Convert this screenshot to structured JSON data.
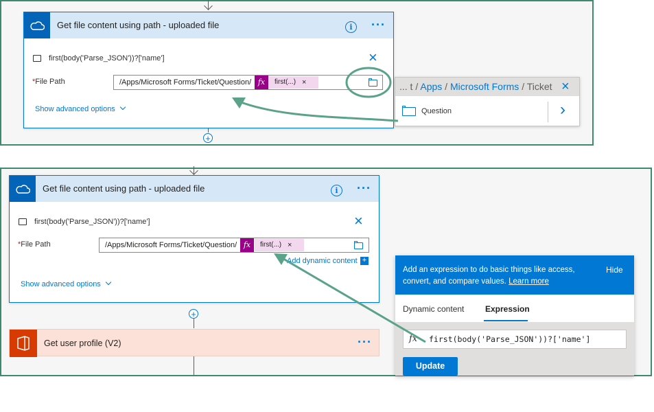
{
  "top_panel": {
    "card": {
      "title": "Get file content using path - uploaded file",
      "info_glyph": "i",
      "more_glyph": "···",
      "expression": "first(body('Parse_JSON'))?['name']",
      "close_glyph": "×",
      "file_path_label": "File Path",
      "required_mark": "*",
      "path_value": "/Apps/Microsoft Forms/Ticket/Question/",
      "fx_glyph": "fx",
      "token_label": "first(...)",
      "token_remove": "×",
      "show_advanced": "Show advanced options"
    },
    "folder_browser": {
      "crumbs": [
        "... t",
        "Apps",
        "Microsoft Forms",
        "Ticket"
      ],
      "separator": "/",
      "close_glyph": "×",
      "item_label": "Question",
      "chevron_glyph": "›"
    },
    "plus_glyph": "+"
  },
  "bottom_panel": {
    "card": {
      "title": "Get file content using path - uploaded file",
      "info_glyph": "i",
      "more_glyph": "···",
      "expression": "first(body('Parse_JSON'))?['name']",
      "close_glyph": "×",
      "file_path_label": "File Path",
      "required_mark": "*",
      "path_value": "/Apps/Microsoft Forms/Ticket/Question/",
      "fx_glyph": "fx",
      "token_label": "first(...)",
      "token_remove": "×",
      "add_dynamic": "Add dynamic content",
      "add_dynamic_plus": "+",
      "show_advanced": "Show advanced options"
    },
    "plus_glyph": "+",
    "profile_card": {
      "title": "Get user profile (V2)",
      "more_glyph": "···"
    },
    "flyout": {
      "description": "Add an expression to do basic things like access, convert, and compare values.",
      "learn_more": "Learn more",
      "hide": "Hide",
      "tabs": [
        "Dynamic content",
        "Expression"
      ],
      "active_tab": "Expression",
      "fx_glyph": "fx",
      "expression_value": "first(body('Parse_JSON'))?['name']",
      "update_label": "Update"
    }
  },
  "colors": {
    "panel_border": "#3f8a6e",
    "accent": "#0078d4",
    "fx_purple": "#9a0089",
    "token_pink": "#f2d7ef",
    "office_orange": "#d83b01"
  }
}
